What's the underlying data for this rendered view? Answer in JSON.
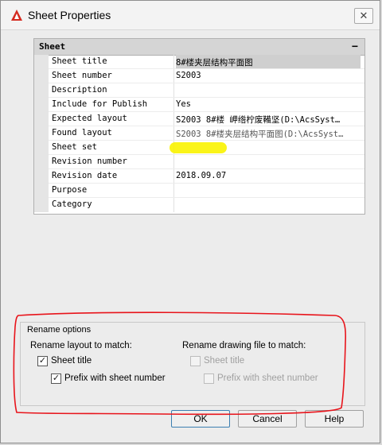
{
  "window": {
    "title": "Sheet Properties",
    "close_glyph": "✕"
  },
  "palette": {
    "category": "Sheet",
    "collapse_glyph": "−",
    "rows": [
      {
        "name": "Sheet title",
        "value": "8#楼夹层结构平面图"
      },
      {
        "name": "Sheet number",
        "value": "S2003"
      },
      {
        "name": "Description",
        "value": ""
      },
      {
        "name": "Include for Publish",
        "value": "Yes"
      },
      {
        "name": "Expected layout",
        "value": "S2003 8#楼 岬绺柠废鞴坚(D:\\AcsSyst…"
      },
      {
        "name": "Found layout",
        "value": "S2003 8#楼夹层结构平面图(D:\\AcsSyst…"
      },
      {
        "name": "Sheet set",
        "value": ""
      },
      {
        "name": "Revision number",
        "value": ""
      },
      {
        "name": "Revision date",
        "value": "2018.09.07"
      },
      {
        "name": "Purpose",
        "value": ""
      },
      {
        "name": "Category",
        "value": ""
      }
    ]
  },
  "rename": {
    "group_title": "Rename options",
    "layout_heading": "Rename layout to match:",
    "file_heading": "Rename drawing file to match:",
    "layout_sheet_title": {
      "label": "Sheet title",
      "checked": true
    },
    "layout_prefix": {
      "label": "Prefix with sheet number",
      "checked": true
    },
    "file_sheet_title": {
      "label": "Sheet title",
      "checked": false
    },
    "file_prefix": {
      "label": "Prefix with sheet number",
      "checked": false
    },
    "check_glyph": "✓"
  },
  "buttons": {
    "ok": "OK",
    "cancel": "Cancel",
    "help": "Help"
  },
  "colors": {
    "highlight": "#f9f300",
    "annotation": "#e8141b"
  }
}
